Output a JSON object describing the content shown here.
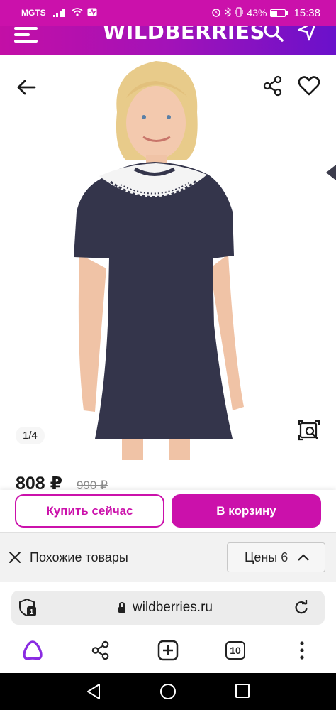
{
  "status_bar": {
    "carrier": "MGTS",
    "battery": "43%",
    "time": "15:38"
  },
  "header": {
    "logo": "WILDBERRIES",
    "icons": [
      "menu-icon",
      "search-icon",
      "geo-arrow-icon"
    ]
  },
  "gallery": {
    "counter": "1/4",
    "icons": [
      "back-arrow-icon",
      "share-icon",
      "heart-icon",
      "visual-search-icon"
    ]
  },
  "product": {
    "price": "808 ₽",
    "old_price": "990 ₽"
  },
  "actions": {
    "buy_now": "Купить сейчас",
    "add_to_cart": "В корзину"
  },
  "similar": {
    "label": "Похожие товары",
    "prices_button": "Цены",
    "prices_count": "6"
  },
  "browser": {
    "url": "wildberries.ru",
    "tab_badge": "1",
    "tabs_count": "10"
  },
  "colors": {
    "brand": "#cb11ab",
    "header_gradient_end": "#6a11cb"
  }
}
